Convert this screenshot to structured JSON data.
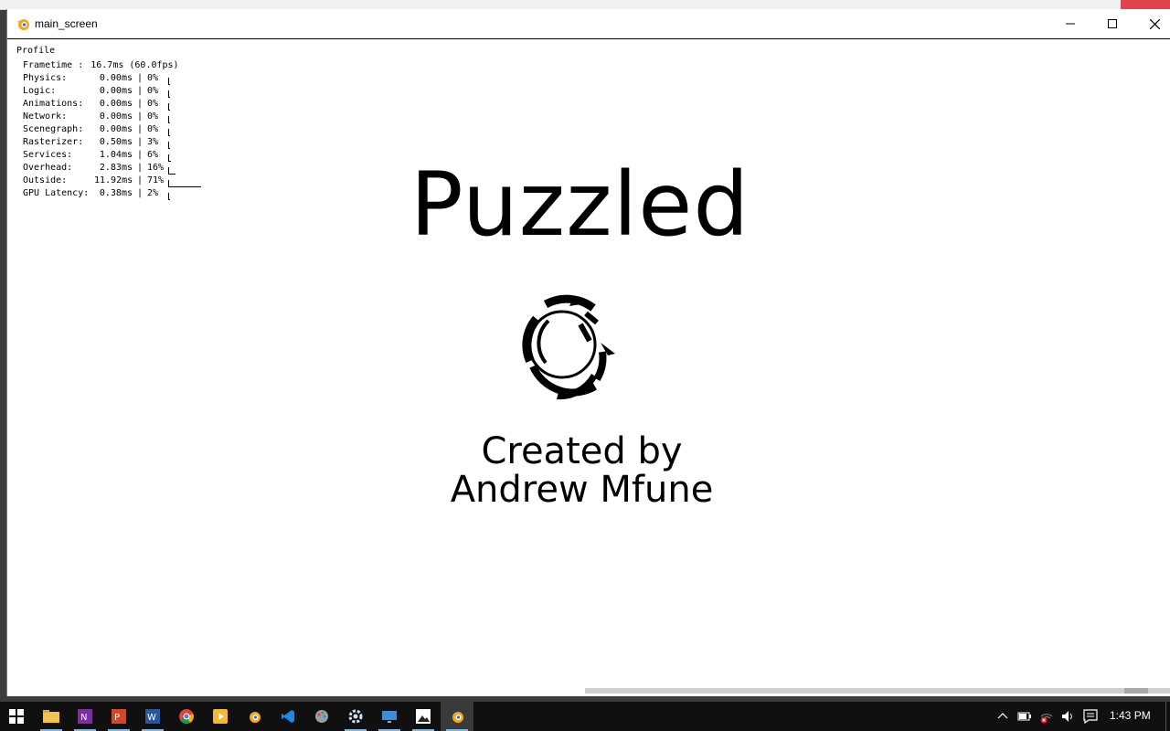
{
  "window": {
    "title": "main_screen"
  },
  "profile": {
    "heading": "Profile",
    "frametime": {
      "label": "Frametime :",
      "value": "16.7ms (60.0fps)"
    },
    "rows": [
      {
        "label": "Physics:",
        "ms": "0.00ms",
        "pct": "0%",
        "fraction": 0.0
      },
      {
        "label": "Logic:",
        "ms": "0.00ms",
        "pct": "0%",
        "fraction": 0.0
      },
      {
        "label": "Animations:",
        "ms": "0.00ms",
        "pct": "0%",
        "fraction": 0.0
      },
      {
        "label": "Network:",
        "ms": "0.00ms",
        "pct": "0%",
        "fraction": 0.0
      },
      {
        "label": "Scenegraph:",
        "ms": "0.00ms",
        "pct": "0%",
        "fraction": 0.0
      },
      {
        "label": "Rasterizer:",
        "ms": "0.50ms",
        "pct": "3%",
        "fraction": 0.03
      },
      {
        "label": "Services:",
        "ms": "1.04ms",
        "pct": "6%",
        "fraction": 0.06
      },
      {
        "label": "Overhead:",
        "ms": "2.83ms",
        "pct": "16%",
        "fraction": 0.16
      },
      {
        "label": "Outside:",
        "ms": "11.92ms",
        "pct": "71%",
        "fraction": 0.71
      },
      {
        "label": "GPU Latency:",
        "ms": "0.38ms",
        "pct": "2%",
        "fraction": 0.02
      }
    ],
    "separator": "|"
  },
  "splash": {
    "title": "Puzzled",
    "credit_line1": "Created by",
    "credit_line2": "Andrew Mfune"
  },
  "taskbar": {
    "clock": "1:43 PM",
    "items": [
      "windows-start",
      "file-explorer",
      "onenote",
      "powerpoint",
      "word",
      "chrome",
      "media-player",
      "blender",
      "vscode",
      "paint-app",
      "settings",
      "remote-desktop",
      "photos",
      "blender-active"
    ]
  },
  "colors": {
    "window_bg": "#ffffff",
    "taskbar_bg": "#101010",
    "text": "#000000"
  }
}
